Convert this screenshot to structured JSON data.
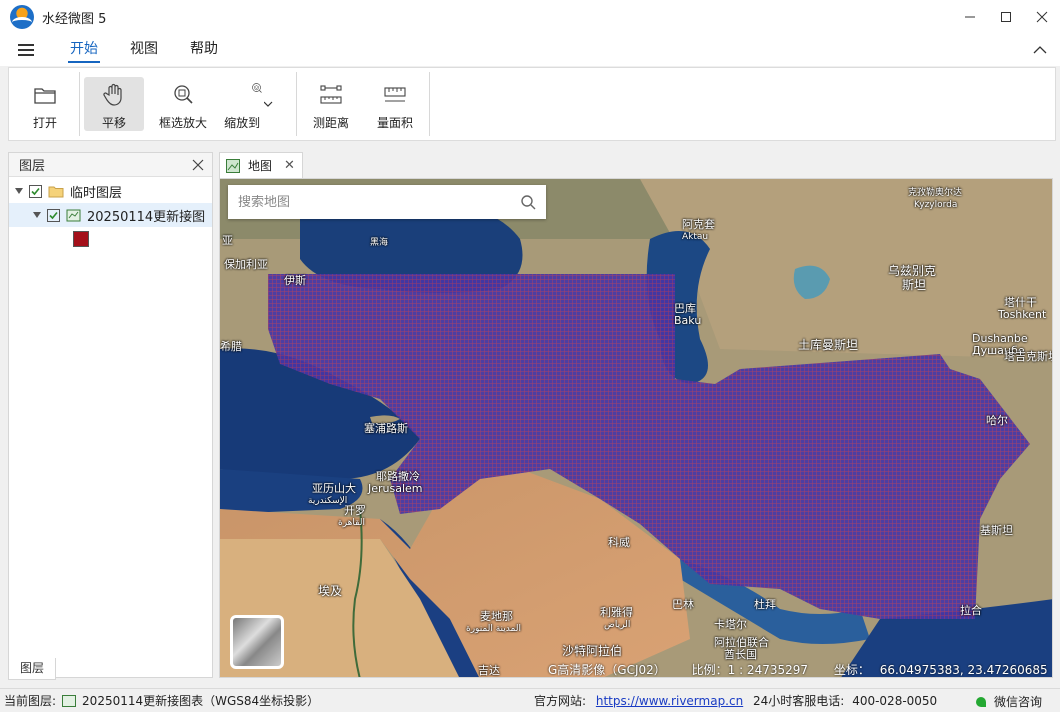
{
  "window": {
    "title": "水经微图 5"
  },
  "menu": {
    "tabs": [
      "开始",
      "视图",
      "帮助"
    ],
    "active": 0
  },
  "ribbon": {
    "open": "打开",
    "pan": "平移",
    "zoom_box": "框选放大",
    "zoom_to": "缩放到",
    "measure_distance": "测距离",
    "measure_area": "量面积"
  },
  "layer_panel": {
    "title": "图层",
    "group": "临时图层",
    "layer": "20250114更新接图",
    "legend_color": "#a4101a",
    "bottom_tab": "图层"
  },
  "map": {
    "tab": "地图",
    "search_placeholder": "搜索地图",
    "grid_color": "#4a3da8",
    "labels": {
      "heihai": "黑海",
      "baojialiya": "保加利亚",
      "baku_cn": "巴库",
      "baku": "Baku",
      "aktau_cn": "阿克套",
      "aktau": "Aktau",
      "kyzylorda_cn": "克孜勒奥尔达",
      "kyzylorda": "Kyzylorda",
      "wuzibieke": "乌兹别克",
      "sitan": "斯坦",
      "tashigan": "塔什干",
      "tashkent": "Toshkent",
      "dushanbe": "Dushanbe",
      "dushanbe_cyr": "Душанбе",
      "tajike": "塔吉克斯坦",
      "tukumansitan": "土库曼斯坦",
      "saipulusi": "塞浦路斯",
      "yalishanda": "亚历山大",
      "yalishanda_ar": "الإسكندرية",
      "kailuo": "开罗",
      "kailuo_ar": "القاهرة",
      "yilusaleng": "耶路撒冷",
      "jerusalem": "Jerusalem",
      "aiji": "埃及",
      "maidina": "麦地那",
      "maidina_ar": "المدينة المنورة",
      "liyade": "利雅得",
      "liyade_ar": "الرياض",
      "shatealabo": "沙特阿拉伯",
      "jida": "吉达",
      "balin": "巴林",
      "kataer": "卡塔尔",
      "dubai": "杜拜",
      "alabo": "阿拉伯联合",
      "qiuzhang": "酋长国",
      "kuweite": "科威",
      "lahe": "拉合",
      "jisitan": "基斯坦",
      "xila": "希腊",
      "yiste": "伊斯",
      "eya": "亚",
      "hane": "哈尔"
    }
  },
  "map_status": {
    "source": "G高清影像（GCJ02）",
    "scale": "比例：1 : 24735297",
    "coord_label": "坐标：",
    "coords": "66.04975383, 23.47260685"
  },
  "statusbar": {
    "current_layer_label": "当前图层:",
    "current_layer": "20250114更新接图表（WGS84坐标投影）",
    "site_label": "官方网站:",
    "site_url": "https://www.rivermap.cn",
    "phone_label": "24小时客服电话:",
    "phone": "400-028-0050",
    "wechat": "微信咨询"
  }
}
